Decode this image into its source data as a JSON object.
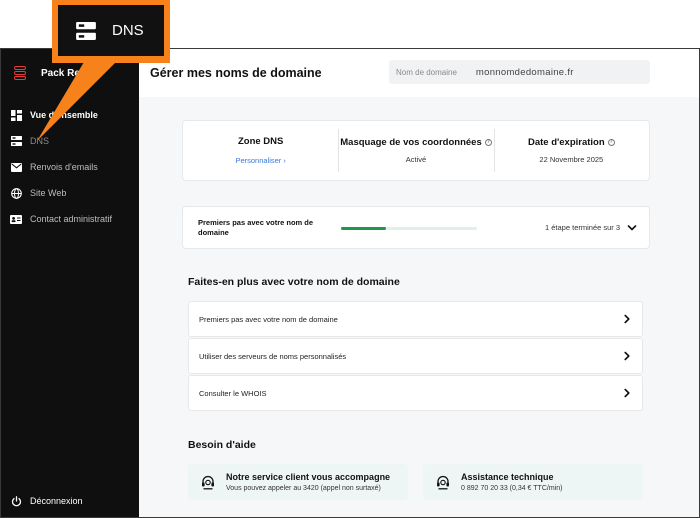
{
  "brand": {
    "name": "Pack Re"
  },
  "sidebar": {
    "items": [
      {
        "label": "Vue d'ensemble",
        "icon": "dashboard-icon",
        "state": "active"
      },
      {
        "label": "DNS",
        "icon": "server-icon",
        "state": "dim"
      },
      {
        "label": "Renvois d'emails",
        "icon": "mail-icon",
        "state": "normal"
      },
      {
        "label": "Site Web",
        "icon": "globe-icon",
        "state": "normal"
      },
      {
        "label": "Contact administratif",
        "icon": "id-card-icon",
        "state": "normal"
      }
    ],
    "logout_label": "Déconnexion"
  },
  "header": {
    "title": "Gérer mes noms de domaine",
    "domain_label": "Nom de domaine",
    "domain_value": "monnomdedomaine.fr"
  },
  "info": {
    "dns_zone": {
      "title": "Zone DNS",
      "link": "Personnaliser"
    },
    "masking": {
      "title": "Masquage de vos coordonnées",
      "status": "Activé"
    },
    "expiration": {
      "title": "Date d'expiration",
      "date": "22 Novembre 2025"
    }
  },
  "progress": {
    "title": "Premiers pas avec votre nom de domaine",
    "status": "1 étape terminée sur 3",
    "completed": 1,
    "total": 3
  },
  "more": {
    "title": "Faites-en plus avec votre nom de domaine",
    "items": [
      "Premiers pas avec votre nom de domaine",
      "Utiliser des serveurs de noms personnalisés",
      "Consulter le WHOIS"
    ]
  },
  "help": {
    "title": "Besoin d'aide",
    "cards": [
      {
        "title": "Notre service client vous accompagne",
        "text": "Vous pouvez appeler au 3420 (appel non surtaxé)"
      },
      {
        "title": "Assistance technique",
        "text": "0 892 70 20 33 (0,34 € TTC/min)"
      }
    ]
  },
  "callout": {
    "label": "DNS",
    "icon": "server-icon"
  },
  "colors": {
    "accent": "#f7821b",
    "progress": "#1a9a46",
    "link": "#3b78d8",
    "brand": "#e43b3b"
  }
}
